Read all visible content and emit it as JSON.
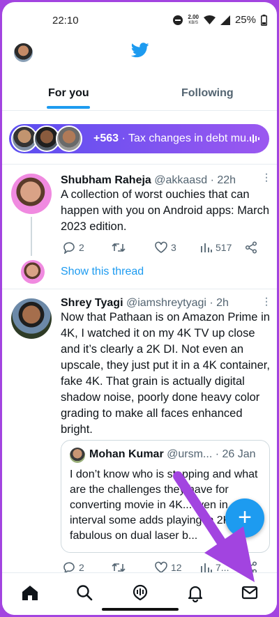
{
  "status_bar": {
    "time": "22:10",
    "network_speed_value": "2.00",
    "network_speed_unit": "KB/S",
    "battery": "25%"
  },
  "tabs": [
    {
      "label": "For you",
      "active": true
    },
    {
      "label": "Following",
      "active": false
    }
  ],
  "spaces_banner": {
    "count": "+563",
    "separator": " · ",
    "text": "Tax changes in debt mu..."
  },
  "tweets": [
    {
      "name": "Shubham Raheja",
      "handle": "@akkaasd",
      "time": "22h",
      "body": "A collection of worst ouchies that can happen with you on Android apps: March 2023 edition.",
      "replies": "2",
      "retweets": "",
      "likes": "3",
      "views": "517",
      "show_thread": "Show this thread"
    },
    {
      "name": "Shrey Tyagi",
      "handle": "@iamshreytyagi",
      "time": "2h",
      "body": "Now that Pathaan is on Amazon Prime in 4K, I watched it on my 4K TV up close and it’s clearly a 2K DI. Not even an upscale, they just put it in a 4K container, fake 4K. That grain is actually digital shadow noise, poorly done heavy color grading to make all faces enhanced bright.",
      "quote": {
        "name": "Mohan Kumar",
        "handle": "@ursm...",
        "date": "26 Jan",
        "body": "I don’t know who is stopping and what are the challenges they have for converting movie in 4K...even in interval some adds playing in 2K looks fabulous on dual laser b..."
      },
      "replies": "2",
      "retweets": "",
      "likes": "12",
      "views": "7..."
    }
  ],
  "fab": {
    "label": "+"
  },
  "bottom_nav": [
    "home-icon",
    "search-icon",
    "spaces-icon",
    "notifications-bell-icon",
    "messages-envelope-icon"
  ],
  "colors": {
    "accent": "#1d9bf0",
    "annotation_arrow": "#a244e0",
    "banner_start": "#5b4ef0",
    "banner_end": "#9b58f0"
  }
}
